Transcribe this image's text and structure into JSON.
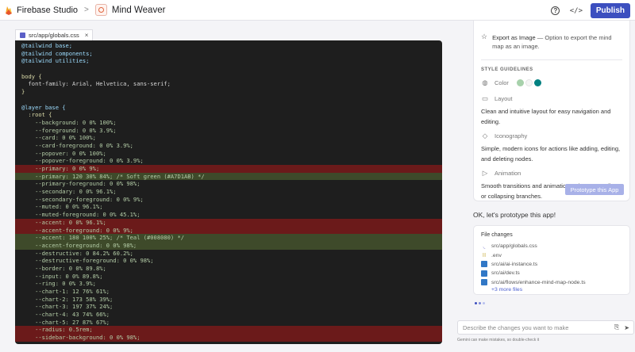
{
  "topbar": {
    "app_name": "Firebase Studio",
    "separator": ">",
    "project_name": "Mind Weaver",
    "help_icon": "help-circle-icon",
    "code_icon": "code-brackets-icon",
    "publish_label": "Publish"
  },
  "editor": {
    "tab_label": "src/app/globals.css",
    "tab_close": "×",
    "lines": [
      {
        "text": "@tailwind base;",
        "kind": "c-dir"
      },
      {
        "text": "@tailwind components;",
        "kind": "c-dir"
      },
      {
        "text": "@tailwind utilities;",
        "kind": "c-dir"
      },
      {
        "text": "",
        "kind": "c-plain"
      },
      {
        "text": "body {",
        "kind": "c-sel"
      },
      {
        "text": "  font-family: Arial, Helvetica, sans-serif;",
        "kind": "c-plain"
      },
      {
        "text": "}",
        "kind": "c-sel"
      },
      {
        "text": "",
        "kind": "c-plain"
      },
      {
        "text": "@layer base {",
        "kind": "c-dir"
      },
      {
        "text": "  :root {",
        "kind": "c-sel"
      },
      {
        "text": "    --background: 0 0% 100%;",
        "kind": "c-val"
      },
      {
        "text": "    --foreground: 0 0% 3.9%;",
        "kind": "c-val"
      },
      {
        "text": "    --card: 0 0% 100%;",
        "kind": "c-val"
      },
      {
        "text": "    --card-foreground: 0 0% 3.9%;",
        "kind": "c-val"
      },
      {
        "text": "    --popover: 0 0% 100%;",
        "kind": "c-val"
      },
      {
        "text": "    --popover-foreground: 0 0% 3.9%;",
        "kind": "c-val"
      },
      {
        "text": "    --primary: 0 0% 9%;",
        "kind": "c-val",
        "diff": "removed"
      },
      {
        "text": "    --primary: 120 30% 84%; /* Soft green (#A7D1AB) */",
        "kind": "c-val",
        "diff": "added"
      },
      {
        "text": "    --primary-foreground: 0 0% 98%;",
        "kind": "c-val"
      },
      {
        "text": "    --secondary: 0 0% 96.1%;",
        "kind": "c-val"
      },
      {
        "text": "    --secondary-foreground: 0 0% 9%;",
        "kind": "c-val"
      },
      {
        "text": "    --muted: 0 0% 96.1%;",
        "kind": "c-val"
      },
      {
        "text": "    --muted-foreground: 0 0% 45.1%;",
        "kind": "c-val"
      },
      {
        "text": "    --accent: 0 0% 96.1%;",
        "kind": "c-val",
        "diff": "removed"
      },
      {
        "text": "    --accent-foreground: 0 0% 9%;",
        "kind": "c-val",
        "diff": "removed"
      },
      {
        "text": "    --accent: 180 100% 25%; /* Teal (#008080) */",
        "kind": "c-val",
        "diff": "added"
      },
      {
        "text": "    --accent-foreground: 0 0% 98%;",
        "kind": "c-val",
        "diff": "added"
      },
      {
        "text": "    --destructive: 0 84.2% 60.2%;",
        "kind": "c-val"
      },
      {
        "text": "    --destructive-foreground: 0 0% 98%;",
        "kind": "c-val"
      },
      {
        "text": "    --border: 0 0% 89.8%;",
        "kind": "c-val"
      },
      {
        "text": "    --input: 0 0% 89.8%;",
        "kind": "c-val"
      },
      {
        "text": "    --ring: 0 0% 3.9%;",
        "kind": "c-val"
      },
      {
        "text": "    --chart-1: 12 76% 61%;",
        "kind": "c-val"
      },
      {
        "text": "    --chart-2: 173 58% 39%;",
        "kind": "c-val"
      },
      {
        "text": "    --chart-3: 197 37% 24%;",
        "kind": "c-val"
      },
      {
        "text": "    --chart-4: 43 74% 66%;",
        "kind": "c-val"
      },
      {
        "text": "    --chart-5: 27 87% 67%;",
        "kind": "c-val"
      },
      {
        "text": "    --radius: 0.5rem;",
        "kind": "c-val",
        "diff": "removed"
      },
      {
        "text": "    --sidebar-background: 0 0% 98%;",
        "kind": "c-val",
        "diff": "removed"
      }
    ]
  },
  "guide": {
    "export_title": "Export as Image",
    "export_desc": " — Option to export the mind map as an image.",
    "style_title": "STYLE GUIDELINES",
    "color_label": "Color",
    "colors": [
      "#a7d1ab",
      "#f5f5f5",
      "#008080"
    ],
    "layout_label": "Layout",
    "layout_desc": "Clean and intuitive layout for easy navigation and editing.",
    "iconography_label": "Iconography",
    "iconography_desc": "Simple, modern icons for actions like adding, editing, and deleting nodes.",
    "animation_label": "Animation",
    "animation_desc": "Smooth transitions and animations when expanding or collapsing branches.",
    "prototype_button": "Prototype this App"
  },
  "chat": {
    "message": "OK, let's prototype this app!",
    "changes_title": "File changes",
    "files": [
      {
        "name": "src/app/globals.css",
        "icon": "css-file-icon"
      },
      {
        "name": ".env",
        "icon": "env-file-icon"
      },
      {
        "name": "src/ai/ai-instance.ts",
        "icon": "ts-file-icon"
      },
      {
        "name": "src/ai/dev.ts",
        "icon": "ts-file-icon"
      },
      {
        "name": "src/ai/flows/enhance-mind-map-node.ts",
        "icon": "ts-file-icon"
      }
    ],
    "more_files": "+3 more files",
    "input_placeholder": "Describe the changes you want to make",
    "disclaimer": "Gemini can make mistakes, so double-check it"
  }
}
